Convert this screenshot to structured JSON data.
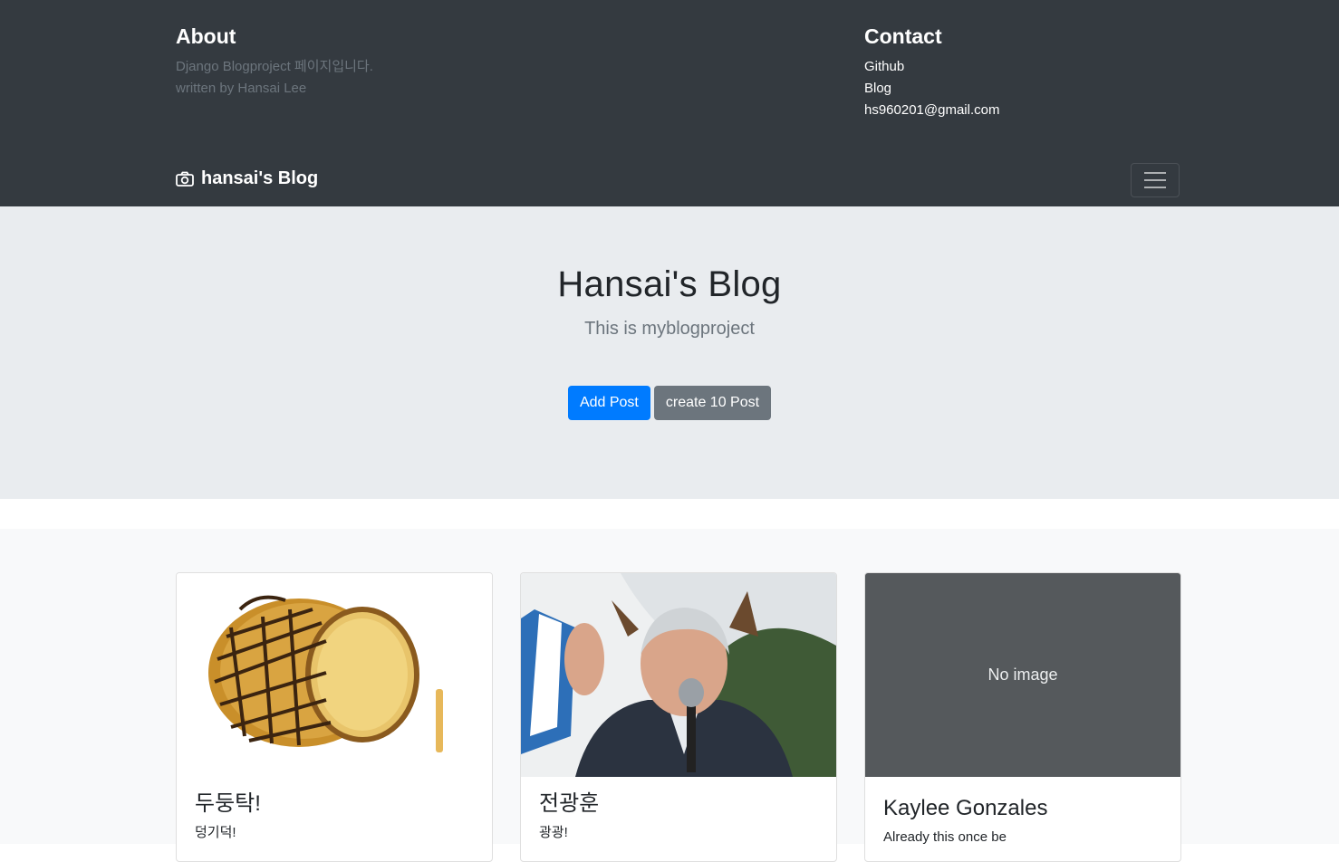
{
  "header": {
    "about": {
      "title": "About",
      "line1": "Django Blogproject 페이지입니다.",
      "line2": "written by Hansai Lee"
    },
    "contact": {
      "title": "Contact",
      "links": [
        "Github",
        "Blog",
        "hs960201@gmail.com"
      ]
    }
  },
  "navbar": {
    "brand": "hansai's Blog",
    "brand_icon": "camera-icon",
    "toggler_icon": "hamburger-icon"
  },
  "jumbotron": {
    "title": "Hansai's Blog",
    "lead": "This is myblogproject",
    "primary_button": "Add Post",
    "secondary_button": "create 10 Post"
  },
  "cards": [
    {
      "image": "drum-image",
      "title": "두둥탁!",
      "text": "덩기덕!"
    },
    {
      "image": "speaker-photo",
      "title": "전광훈",
      "text": "광광!"
    },
    {
      "image": "placeholder",
      "image_text": "No image",
      "title": "Kaylee Gonzales",
      "text": "Already this once be"
    }
  ],
  "colors": {
    "navbar_bg": "#343a40",
    "jumbotron_bg": "#e9ecef",
    "album_bg": "#f8f9fa",
    "primary": "#007bff",
    "secondary": "#6c757d",
    "placeholder_bg": "#55595c"
  }
}
